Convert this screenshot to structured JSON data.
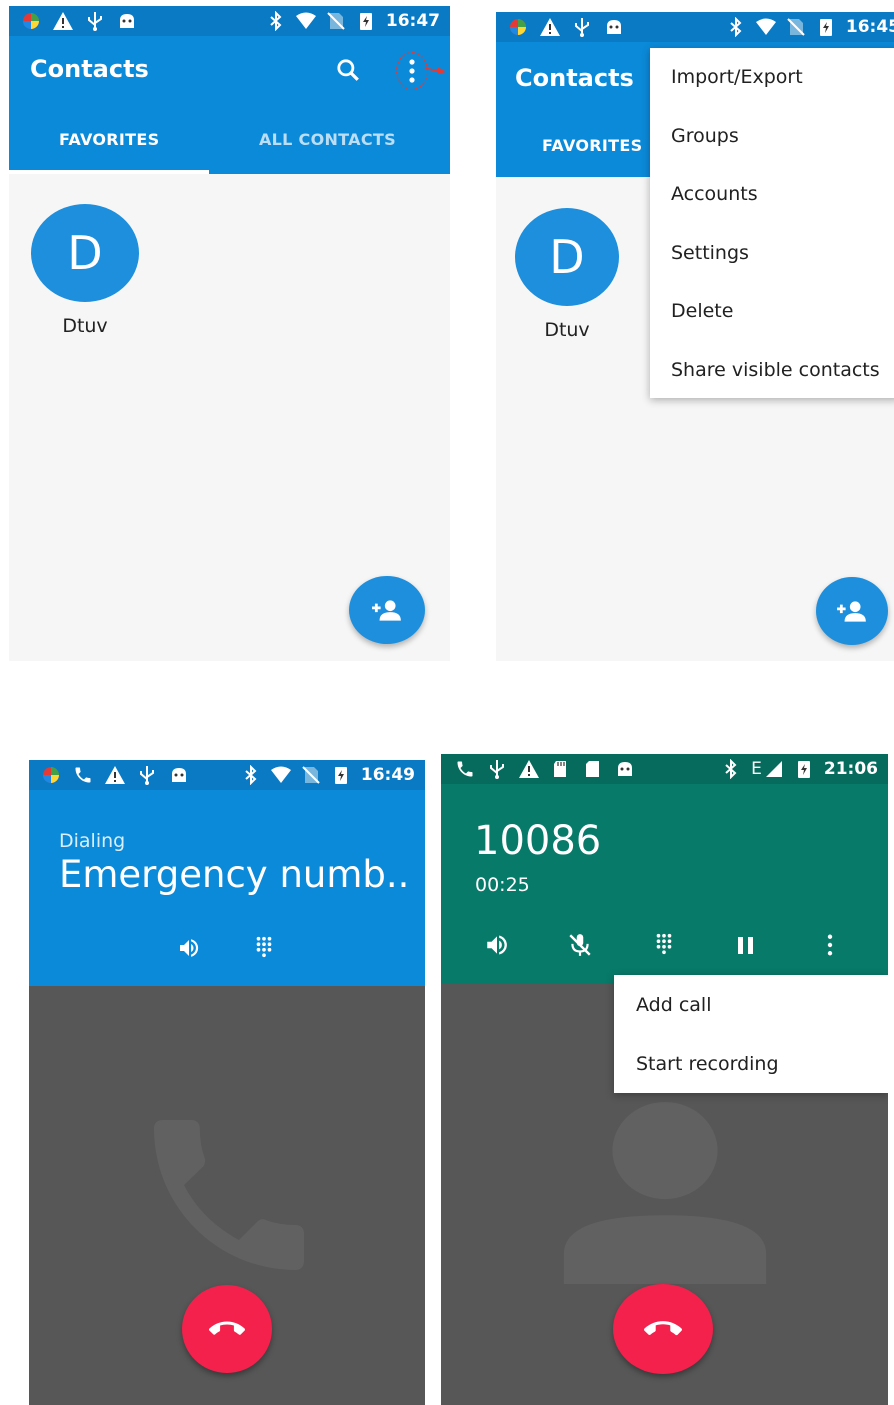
{
  "colors": {
    "contacts_blue": "#0b8ad9",
    "status_blue": "#0a7ac4",
    "dialer_green": "#087a6a",
    "status_green": "#066b5d",
    "call_bg": "#575757",
    "end_call_red": "#f4214c"
  },
  "screen1": {
    "status": {
      "time": "16:47"
    },
    "appbar": {
      "title": "Contacts"
    },
    "tabs": [
      {
        "label": "FAVORITES",
        "selected": true
      },
      {
        "label": "ALL CONTACTS",
        "selected": false
      }
    ],
    "favorite": {
      "initial": "D",
      "name": "Dtuv"
    },
    "icons": [
      "search-icon",
      "more-vert-icon",
      "add-contact-icon"
    ]
  },
  "screen2": {
    "status": {
      "time": "16:45"
    },
    "appbar": {
      "title": "Contacts"
    },
    "tabs": [
      {
        "label": "FAVORITES",
        "selected": true
      }
    ],
    "favorite": {
      "initial": "D",
      "name": "Dtuv"
    },
    "menu": [
      "Import/Export",
      "Groups",
      "Accounts",
      "Settings",
      "Delete",
      "Share visible contacts"
    ]
  },
  "screen3": {
    "status": {
      "time": "16:49"
    },
    "call": {
      "state": "Dialing",
      "name": "Emergency numb.."
    },
    "icons": [
      "speaker-icon",
      "dialpad-icon",
      "end-call-icon"
    ]
  },
  "screen4": {
    "status": {
      "time": "21:06",
      "network": "E"
    },
    "call": {
      "number": "10086",
      "duration": "00:25"
    },
    "menu": [
      "Add call",
      "Start recording"
    ],
    "icons": [
      "speaker-icon",
      "mute-icon",
      "dialpad-icon",
      "pause-icon",
      "more-vert-icon",
      "end-call-icon"
    ]
  }
}
